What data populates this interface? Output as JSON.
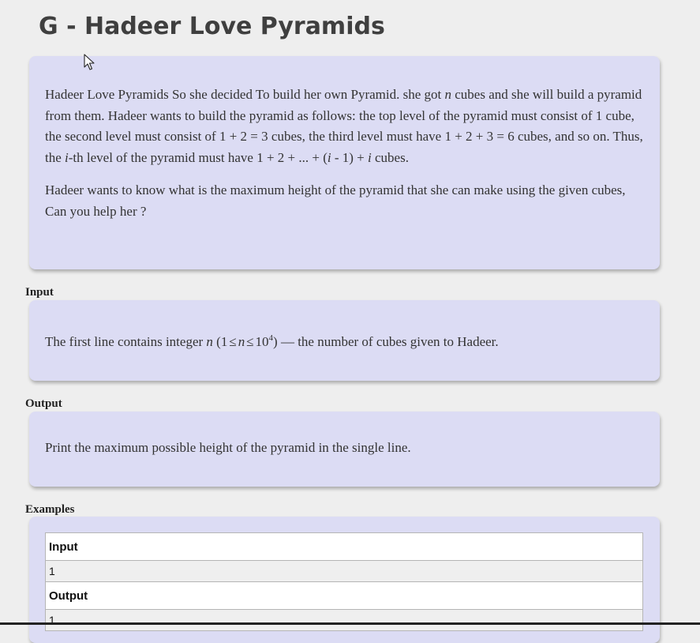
{
  "problem": {
    "title": "G - Hadeer Love Pyramids"
  },
  "statement": {
    "p1": {
      "s1": "Hadeer Love Pyramids So she decided To build her own Pyramid. she got ",
      "var_n": "n",
      "s2": " cubes and she will build a pyramid from them. Hadeer wants to build the pyramid as follows: the top level of the pyramid must consist of 1 cube, the second level must consist of ",
      "eq1": "1 + 2 = 3",
      "s3": " cubes, the third level must have ",
      "eq2": "1 + 2 + 3 = 6",
      "s4": " cubes, and so on. Thus, the ",
      "var_i": "i",
      "s5": "-th level of the pyramid must have ",
      "eq3a": "1 + 2 + ... + (",
      "eq3i": "i",
      "eq3b": " - 1) + ",
      "eq3c": "i",
      "s6": " cubes."
    },
    "p2": "Hadeer wants to know what is the maximum height of the pyramid that she can make using the given cubes, Can you help her ?"
  },
  "input_section": {
    "label": "Input",
    "t1": "The first line contains integer ",
    "var_n": "n",
    "c_open": " (1",
    "le1": "≤",
    "var_n2": "n",
    "le2": "≤",
    "pow_base": "10",
    "pow_exp": "4",
    "c_close": ")",
    "t2": " — the number of cubes given to Hadeer."
  },
  "output_section": {
    "label": "Output",
    "text": "Print the maximum possible height of the pyramid in the single line."
  },
  "examples": {
    "label": "Examples",
    "input_header": "Input",
    "input_value": "1",
    "output_header": "Output",
    "output_value": "1"
  },
  "colors": {
    "card_background": "#dcdcf4",
    "page_background": "#eeeeee"
  },
  "icons": {
    "cursor": "mouse-pointer-icon"
  }
}
